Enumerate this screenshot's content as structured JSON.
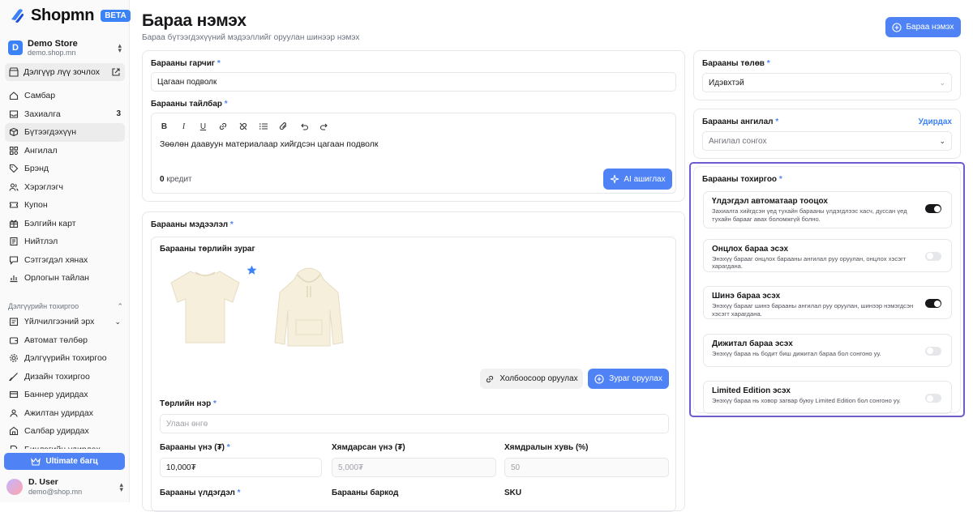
{
  "brand": {
    "name": "Shopmn",
    "badge": "BETA"
  },
  "store": {
    "initial": "D",
    "name": "Demo Store",
    "url": "demo.shop.mn"
  },
  "visit_store": "Дэлгүүр лүү зочлох",
  "nav": [
    {
      "label": "Самбар",
      "icon": "home-icon"
    },
    {
      "label": "Захиалга",
      "icon": "inbox-icon",
      "count": "3"
    },
    {
      "label": "Бүтээгдэхүүн",
      "icon": "box-icon",
      "active": true
    },
    {
      "label": "Ангилал",
      "icon": "category-icon"
    },
    {
      "label": "Брэнд",
      "icon": "tag-icon"
    },
    {
      "label": "Хэрэглэгч",
      "icon": "users-icon"
    },
    {
      "label": "Купон",
      "icon": "ticket-icon"
    },
    {
      "label": "Бэлгийн карт",
      "icon": "gift-icon"
    },
    {
      "label": "Нийтлэл",
      "icon": "article-icon"
    },
    {
      "label": "Сэтгэгдэл хянах",
      "icon": "comment-icon"
    },
    {
      "label": "Орлогын тайлан",
      "icon": "chart-icon"
    }
  ],
  "settings_section": "Дэлгүүрийн тохиргоо",
  "nav2": [
    {
      "label": "Үйлчилгээний эрх",
      "icon": "badge-icon",
      "chevron": true
    },
    {
      "label": "Автомат төлбөр",
      "icon": "wallet-icon"
    },
    {
      "label": "Дэлгүүрийн тохиргоо",
      "icon": "gear-icon"
    },
    {
      "label": "Дизайн тохиргоо",
      "icon": "brush-icon"
    },
    {
      "label": "Баннер удирдах",
      "icon": "banner-icon"
    },
    {
      "label": "Ажилтан удирдах",
      "icon": "staff-icon"
    },
    {
      "label": "Салбар удирдах",
      "icon": "branch-icon"
    },
    {
      "label": "Бичлэгийн удирдах",
      "icon": "file-icon"
    }
  ],
  "ultimate_label": "Ultimate багц",
  "user": {
    "name": "D. User",
    "email": "demo@shop.mn"
  },
  "page": {
    "title": "Бараа нэмэх",
    "subtitle": "Бараа бүтээгдэхүүний мэдээллийг оруулан шинээр нэмэх",
    "add_button": "Бараа нэмэх"
  },
  "title_field": {
    "label": "Барааны гарчиг",
    "required": "*",
    "value": "Цагаан подволк"
  },
  "desc_field": {
    "label": "Барааны тайлбар",
    "required": "*",
    "value": "Зөөлөн даавуун материалаар хийгдсэн цагаан подволк",
    "credits": "0",
    "credits_label": "кредит",
    "ai_button": "AI ашиглах"
  },
  "info": {
    "label": "Барааны мэдээлэл",
    "required": "*",
    "variant_image_label": "Барааны төрлийн зураг",
    "link_upload": "Холбоосоор оруулах",
    "image_upload": "Зураг оруулах",
    "variant_name_label": "Төрлийн нэр",
    "variant_name_placeholder": "Улаан өнгө",
    "price_label": "Барааны үнэ (₮)",
    "price_value": "10,000₮",
    "discount_price_label": "Хямдарсан үнэ (₮)",
    "discount_price_placeholder": "5,000₮",
    "discount_pct_label": "Хямдралын хувь (%)",
    "discount_pct_placeholder": "50",
    "stock_label": "Барааны үлдэгдэл",
    "barcode_label": "Барааны баркод",
    "sku_label": "SKU"
  },
  "status": {
    "label": "Барааны төлөв",
    "required": "*",
    "value": "Идэвхтэй"
  },
  "category": {
    "label": "Барааны ангилал",
    "required": "*",
    "manage": "Удирдах",
    "placeholder": "Ангилал сонгох"
  },
  "settings": {
    "label": "Барааны тохиргоо",
    "required": "*",
    "items": [
      {
        "title": "Үлдэгдэл автоматаар тооцох",
        "desc": "Захиалга хийгдсэн үед тухайн барааны үлдэгдлээс хасч, дуссан үед тухайн бараaг авах боломжгүй болно.",
        "on": true
      },
      {
        "title": "Онцлох бараа эсэх",
        "desc": "Энэхүү бараaг онцлох барааны ангилал руу оруулан, онцлох хэсэгт харагдана.",
        "on": false
      },
      {
        "title": "Шинэ бараа эсэх",
        "desc": "Энэхүү бараaг шинэ барааны ангилал руу оруулан, шинээр нэмэгдсэн хэсэгт харагдана.",
        "on": true
      },
      {
        "title": "Дижитал бараа эсэх",
        "desc": "Энэхүү бараа нь бодит биш дижитал бараа бол сонгоно уу.",
        "on": false
      },
      {
        "title": "Limited Edition эсэх",
        "desc": "Энэхүү бараа нь ховор загвар буюу Limited Edition бол сонгоно уу.",
        "on": false
      }
    ]
  },
  "colors": {
    "accent": "#4f83f5",
    "highlight": "#6d5bd0"
  }
}
